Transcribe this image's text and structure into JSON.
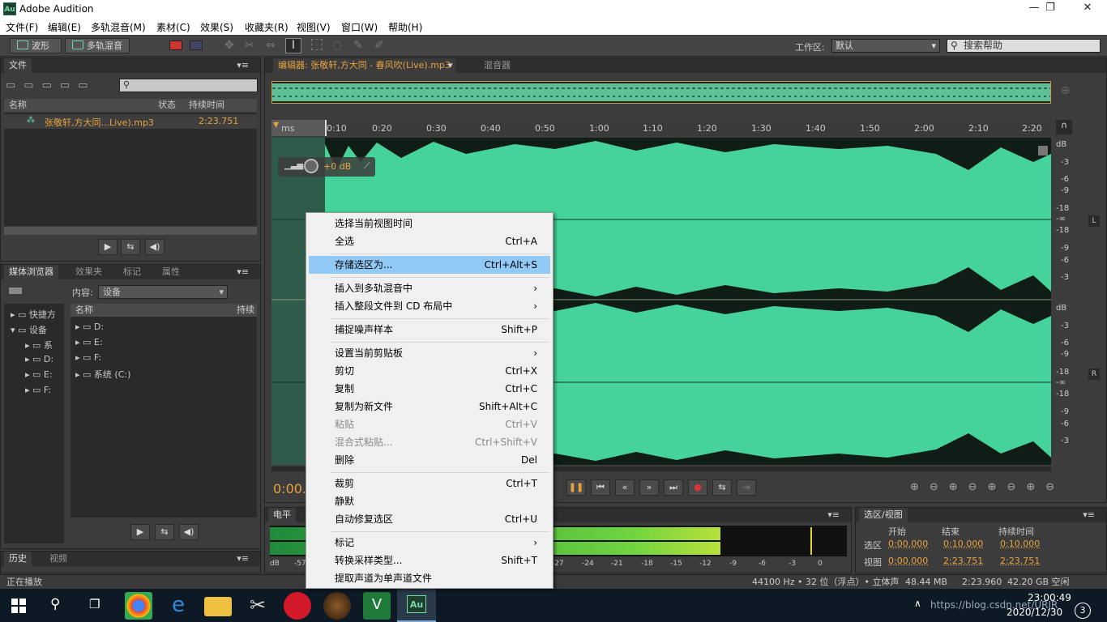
{
  "title": {
    "logo": "Au",
    "app": "Adobe Audition"
  },
  "window": {
    "minimize": "—",
    "maximize": "❐",
    "close": "✕"
  },
  "menu": [
    "文件(F)",
    "编辑(E)",
    "多轨混音(M)",
    "素材(C)",
    "效果(S)",
    "收藏夹(R)",
    "视图(V)",
    "窗口(W)",
    "帮助(H)"
  ],
  "toolbar": {
    "waveform": "波形",
    "multitrack": "多轨混音",
    "workspace_label": "工作区:",
    "workspace_value": "默认",
    "search_placeholder": "搜索帮助"
  },
  "files_panel": {
    "tab": "文件",
    "cols": {
      "name": "名称",
      "status": "状态",
      "duration": "持续时间"
    },
    "file_name": "张敬轩,方大同...Live).mp3",
    "file_duration": "2:23.751"
  },
  "media_panel": {
    "tabs": [
      "媒体浏览器",
      "效果夹",
      "标记",
      "属性"
    ],
    "content_label": "内容:",
    "content_value": "设备",
    "col_name": "名称",
    "col_duration": "持续",
    "left_items": [
      "快捷方",
      "设备",
      "系",
      "D:",
      "E:",
      "F:"
    ],
    "drives": [
      "D:",
      "E:",
      "F:",
      "系统 (C:)"
    ]
  },
  "editor": {
    "tab": "编辑器: 张敬轩,方大同 - 春风吹(Live).mp3",
    "mixer_tab": "混音器",
    "time_display": "0:00.3",
    "hms": "ms",
    "gain": "+0 dB",
    "ruler": [
      "0:10",
      "0:20",
      "0:30",
      "0:40",
      "0:50",
      "1:00",
      "1:10",
      "1:20",
      "1:30",
      "1:40",
      "1:50",
      "2:00",
      "2:10",
      "2:20"
    ],
    "db_scale_top": [
      "dB",
      "-3",
      "-6",
      "-9",
      "-18",
      "-∞",
      "-18",
      "-9",
      "-6",
      "-3"
    ],
    "db_scale_bot": [
      "dB",
      "-3",
      "-6",
      "-9",
      "-18",
      "-∞",
      "-18",
      "-9",
      "-6",
      "-3"
    ],
    "ch_l": "L",
    "ch_r": "R"
  },
  "context_menu": [
    {
      "label": "选择当前视图时间",
      "shortcut": ""
    },
    {
      "label": "全选",
      "shortcut": "Ctrl+A"
    },
    {
      "label": "存储选区为...",
      "shortcut": "Ctrl+Alt+S"
    },
    {
      "label": "插入到多轨混音中",
      "shortcut": "›"
    },
    {
      "label": "插入整段文件到 CD 布局中",
      "shortcut": "›"
    },
    {
      "label": "捕捉噪声样本",
      "shortcut": "Shift+P"
    },
    {
      "label": "设置当前剪贴板",
      "shortcut": "›"
    },
    {
      "label": "剪切",
      "shortcut": "Ctrl+X"
    },
    {
      "label": "复制",
      "shortcut": "Ctrl+C"
    },
    {
      "label": "复制为新文件",
      "shortcut": "Shift+Alt+C"
    },
    {
      "label": "粘贴",
      "shortcut": "Ctrl+V"
    },
    {
      "label": "混合式粘贴...",
      "shortcut": "Ctrl+Shift+V"
    },
    {
      "label": "删除",
      "shortcut": "Del"
    },
    {
      "label": "裁剪",
      "shortcut": "Ctrl+T"
    },
    {
      "label": "静默",
      "shortcut": ""
    },
    {
      "label": "自动修复选区",
      "shortcut": "Ctrl+U"
    },
    {
      "label": "标记",
      "shortcut": "›"
    },
    {
      "label": "转换采样类型...",
      "shortcut": "Shift+T"
    },
    {
      "label": "提取声道为单声道文件",
      "shortcut": ""
    }
  ],
  "level_panel": {
    "tab": "电平",
    "scale": [
      "dB",
      "-57",
      "0",
      "-27",
      "-24",
      "-21",
      "-18",
      "-15",
      "-12",
      "-9",
      "-6",
      "-3",
      "0"
    ]
  },
  "selection_panel": {
    "tab": "选区/视图",
    "cols": [
      "开始",
      "结束",
      "持续时间"
    ],
    "rows": [
      {
        "label": "选区",
        "start": "0:00.000",
        "end": "0:10.000",
        "dur": "0:10.000"
      },
      {
        "label": "视图",
        "start": "0:00.000",
        "end": "2:23.751",
        "dur": "2:23.751"
      }
    ]
  },
  "history_panel": {
    "tabs": [
      "历史",
      "视频"
    ]
  },
  "status": {
    "left": "正在播放",
    "rate": "44100 Hz • 32 位（浮点）• 立体声",
    "size": "48.44 MB",
    "time": "2:23.960",
    "free": "42.20 GB 空闲"
  },
  "taskbar": {
    "time": "23:00:49",
    "date": "2020/12/30",
    "watermark": "https://blog.csdn.net/URJR"
  }
}
